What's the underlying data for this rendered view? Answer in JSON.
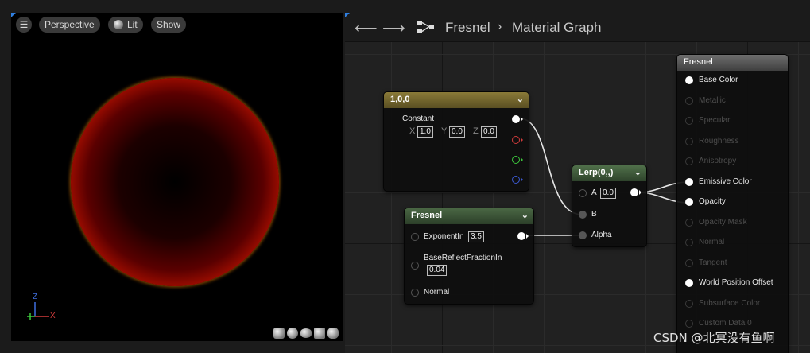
{
  "viewport": {
    "menu_glyph": "☰",
    "perspective_label": "Perspective",
    "lit_label": "Lit",
    "show_label": "Show",
    "axis_z": "Z",
    "axis_x": "X",
    "preview_shapes": [
      "cylinder-icon",
      "sphere-icon",
      "plane-icon",
      "cube-icon",
      "teapot-icon"
    ]
  },
  "toolbar": {
    "back_glyph": "⟵",
    "forward_glyph": "⟶",
    "crumb_1": "Fresnel",
    "crumb_sep": "›",
    "crumb_2": "Material Graph"
  },
  "nodes": {
    "constant": {
      "title": "1,0,0",
      "output_label": "Constant",
      "x_label": "X",
      "x_value": "1.0",
      "y_label": "Y",
      "y_value": "0.0",
      "z_label": "Z",
      "z_value": "0.0",
      "channel_colors": [
        "#d23c3c",
        "#3cc83c",
        "#3c5ad2"
      ]
    },
    "fresnel": {
      "title": "Fresnel",
      "exponent_label": "ExponentIn",
      "exponent_value": "3.5",
      "base_reflect_label": "BaseReflectFractionIn",
      "base_reflect_value": "0.04",
      "normal_label": "Normal"
    },
    "lerp": {
      "title": "Lerp(0,,)",
      "a_label": "A",
      "a_value": "0.0",
      "b_label": "B",
      "alpha_label": "Alpha"
    },
    "result": {
      "title": "Fresnel",
      "pins": [
        {
          "label": "Base Color",
          "active": true
        },
        {
          "label": "Metallic",
          "active": false
        },
        {
          "label": "Specular",
          "active": false
        },
        {
          "label": "Roughness",
          "active": false
        },
        {
          "label": "Anisotropy",
          "active": false
        },
        {
          "label": "Emissive Color",
          "active": true
        },
        {
          "label": "Opacity",
          "active": true
        },
        {
          "label": "Opacity Mask",
          "active": false
        },
        {
          "label": "Normal",
          "active": false
        },
        {
          "label": "Tangent",
          "active": false
        },
        {
          "label": "World Position Offset",
          "active": true
        },
        {
          "label": "Subsurface Color",
          "active": false
        },
        {
          "label": "Custom Data 0",
          "active": false
        }
      ]
    }
  },
  "watermark": "CSDN @北冥没有鱼啊"
}
